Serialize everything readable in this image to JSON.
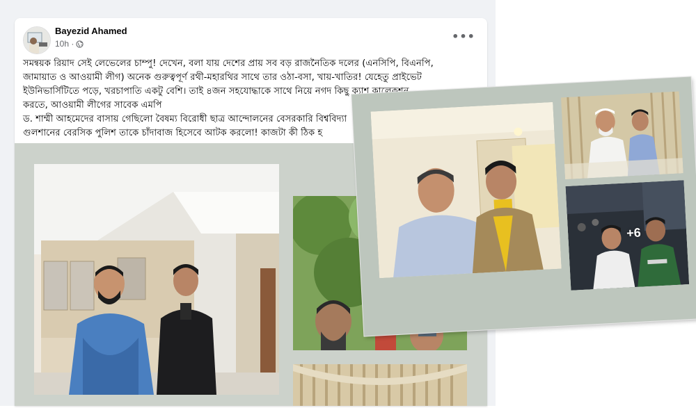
{
  "post": {
    "author": "Bayezid Ahamed",
    "time": "10h · ",
    "more_label": "•••",
    "text": "সমন্বয়ক রিয়াদ সেই লেভেলের চাম্পু! দেখেন, বলা যায় দেশের প্রায় সব বড় রাজনৈতিক দলের (এনসিপি, বিএনপি,\nজামায়াত ও আওয়ামী লীগ) অনেক গুরুত্বপূর্ণ রথী-মহারথির সাথে তার ওঠা-বসা, খায়-খাতির! যেহেতু প্রাইভেট\nইউনিভার্সিটিতে পড়ে, খরচাপাতি একটু বেশি। তাই ৪জন সহযোদ্ধাকে সাথে নিয়ে নগদ কিছু ক্যাশ কালেকশন\nকরতে, আওয়ামী লীগের সাবেক এমপি\nড. শাম্মী আহমেদের বাসায় গেছিলো বৈষম্য বিরোধী ছাত্র আন্দোলনের বেসরকারি বিশ্ববিদ্যা\nগুলশানের বেরসিক পুলিশ তাকে চাঁদাবাজ হিসেবে আটক করলো! কাজটা কী ঠিক হ"
  },
  "photos": {
    "more_count": "+6"
  },
  "colors": {
    "page_bg": "#f0f2f5",
    "photo_area_bg": "#ccd2cb",
    "overlay_bg": "#bdc6bd"
  },
  "icons": [
    "globe-icon",
    "more-options-icon"
  ]
}
